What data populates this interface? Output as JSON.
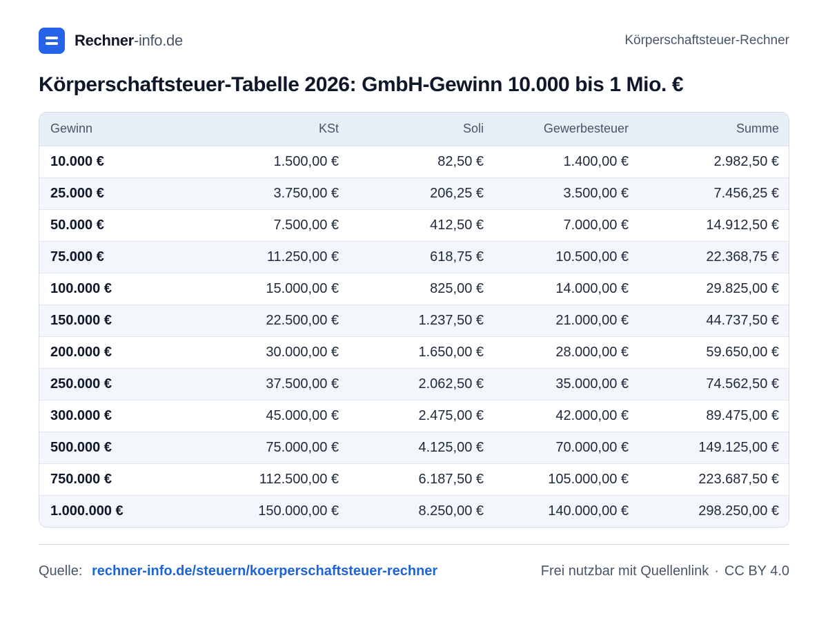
{
  "header": {
    "brand_strong": "Rechner",
    "brand_light": "-info.de",
    "right_label": "Körperschaftsteuer-Rechner"
  },
  "title": "Körperschaftsteuer-Tabelle 2026: GmbH-Gewinn 10.000 bis 1 Mio. €",
  "table": {
    "columns": [
      "Gewinn",
      "KSt",
      "Soli",
      "Gewerbesteuer",
      "Summe"
    ],
    "rows": [
      [
        "10.000 €",
        "1.500,00 €",
        "82,50 €",
        "1.400,00 €",
        "2.982,50 €"
      ],
      [
        "25.000 €",
        "3.750,00 €",
        "206,25 €",
        "3.500,00 €",
        "7.456,25 €"
      ],
      [
        "50.000 €",
        "7.500,00 €",
        "412,50 €",
        "7.000,00 €",
        "14.912,50 €"
      ],
      [
        "75.000 €",
        "11.250,00 €",
        "618,75 €",
        "10.500,00 €",
        "22.368,75 €"
      ],
      [
        "100.000 €",
        "15.000,00 €",
        "825,00 €",
        "14.000,00 €",
        "29.825,00 €"
      ],
      [
        "150.000 €",
        "22.500,00 €",
        "1.237,50 €",
        "21.000,00 €",
        "44.737,50 €"
      ],
      [
        "200.000 €",
        "30.000,00 €",
        "1.650,00 €",
        "28.000,00 €",
        "59.650,00 €"
      ],
      [
        "250.000 €",
        "37.500,00 €",
        "2.062,50 €",
        "35.000,00 €",
        "74.562,50 €"
      ],
      [
        "300.000 €",
        "45.000,00 €",
        "2.475,00 €",
        "42.000,00 €",
        "89.475,00 €"
      ],
      [
        "500.000 €",
        "75.000,00 €",
        "4.125,00 €",
        "70.000,00 €",
        "149.125,00 €"
      ],
      [
        "750.000 €",
        "112.500,00 €",
        "6.187,50 €",
        "105.000,00 €",
        "223.687,50 €"
      ],
      [
        "1.000.000 €",
        "150.000,00 €",
        "8.250,00 €",
        "140.000,00 €",
        "298.250,00 €"
      ]
    ]
  },
  "footer": {
    "source_label": "Quelle:",
    "source_link": "rechner-info.de/steuern/koerperschaftsteuer-rechner",
    "license_text": "Frei nutzbar mit Quellenlink",
    "separator": "·",
    "license": "CC BY 4.0"
  },
  "colors": {
    "accent": "#2563eb",
    "link": "#1d63d8",
    "header_row": "#e8eef6",
    "zebra_row": "#f3f6fb"
  }
}
